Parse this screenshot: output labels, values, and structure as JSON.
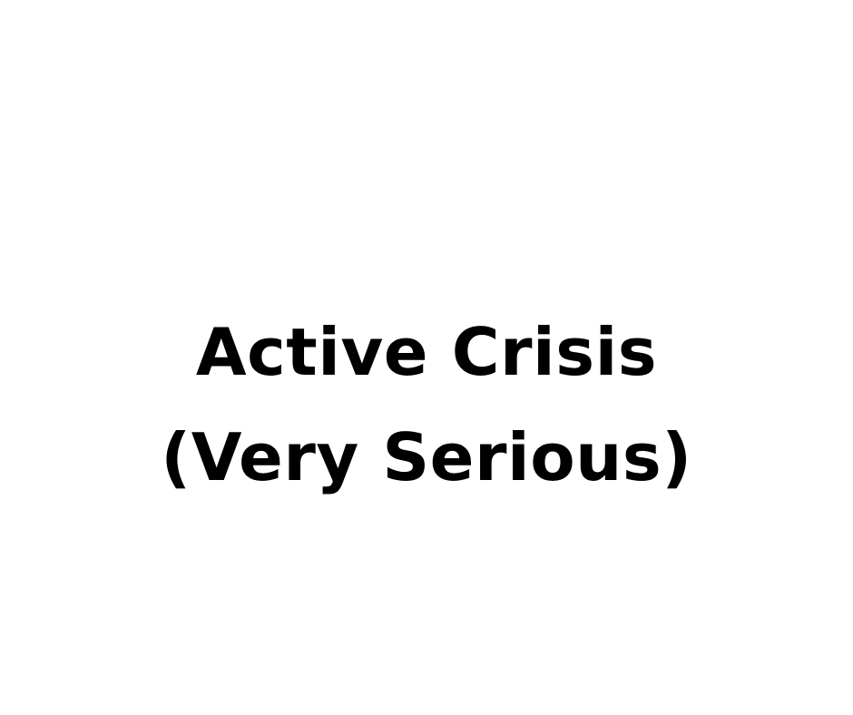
{
  "heading": {
    "line1": "Active Crisis",
    "line2": "(Very Serious)"
  },
  "colors": {
    "background": "#ffffff",
    "text": "#000000"
  }
}
